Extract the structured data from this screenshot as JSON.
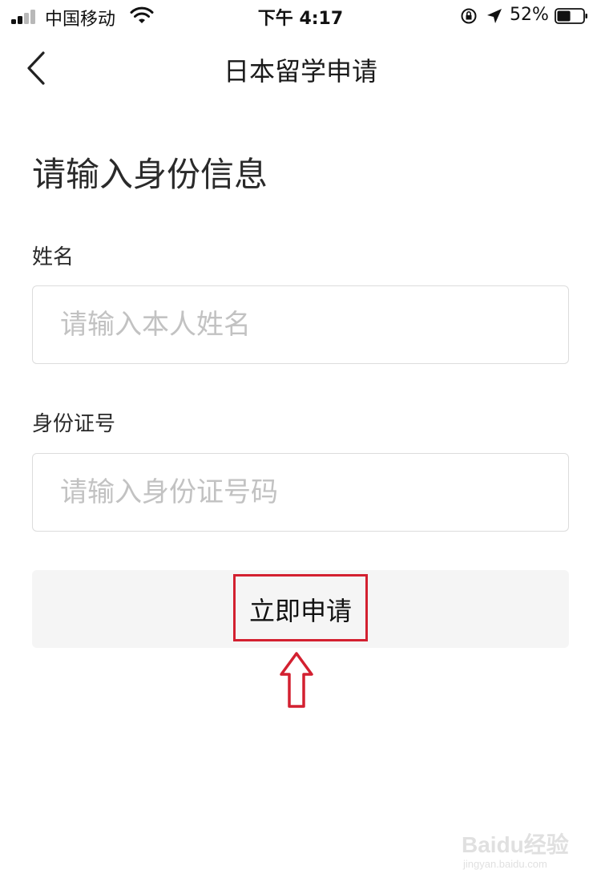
{
  "status_bar": {
    "carrier": "中国移动",
    "time": "下午 4:17",
    "battery_percent": "52%",
    "signal_icon": "signal-icon",
    "wifi_icon": "wifi-icon",
    "battery_level": 0.52
  },
  "nav": {
    "title": "日本留学申请",
    "back_icon": "chevron-left-icon"
  },
  "form": {
    "heading": "请输入身份信息",
    "name_label": "姓名",
    "name_placeholder": "请输入本人姓名",
    "name_value": "",
    "id_label": "身份证号",
    "id_placeholder": "请输入身份证号码",
    "id_value": "",
    "submit_label": "立即申请"
  },
  "annotation": {
    "color": "#d32030",
    "arrow_icon": "up-arrow-icon"
  },
  "watermark": {
    "logo": "Baidu经验",
    "url": "jingyan.baidu.com"
  }
}
